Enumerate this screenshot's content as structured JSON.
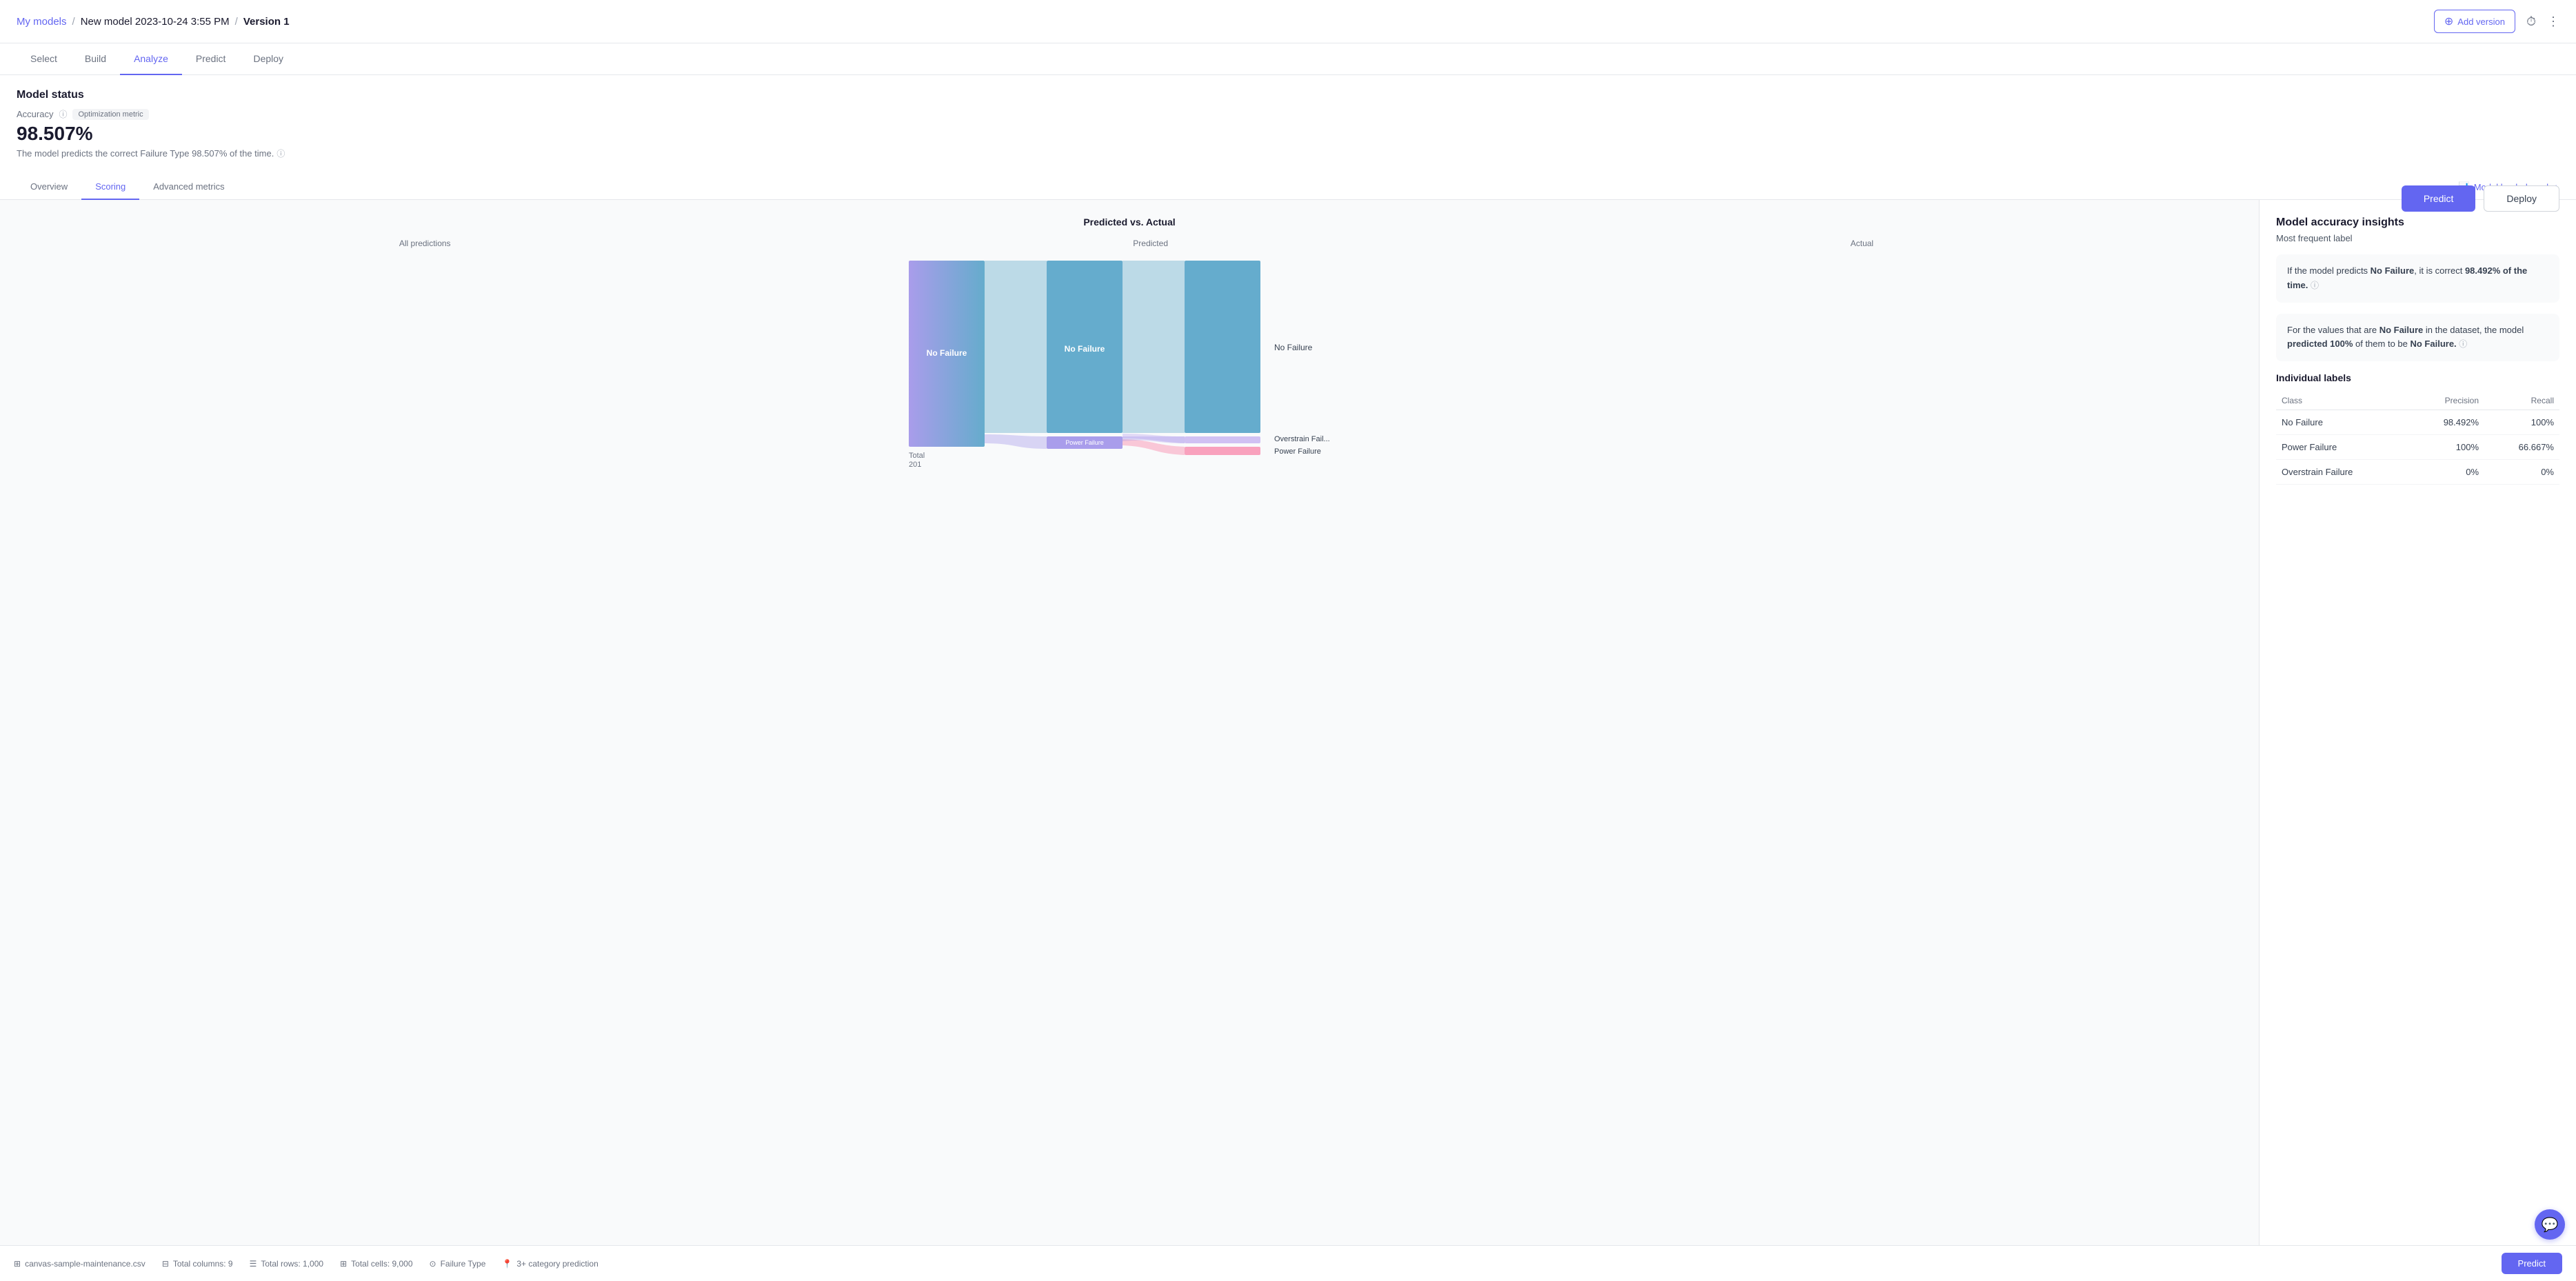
{
  "header": {
    "breadcrumb": "My models / New model 2023-10-24 3:55 PM / Version 1",
    "my_models": "My models",
    "separator1": "/",
    "model_name": "New model 2023-10-24 3:55 PM",
    "separator2": "/",
    "version": "Version 1",
    "add_version_label": "Add version"
  },
  "nav": {
    "tabs": [
      {
        "label": "Select",
        "active": false
      },
      {
        "label": "Build",
        "active": false
      },
      {
        "label": "Analyze",
        "active": true
      },
      {
        "label": "Predict",
        "active": false
      },
      {
        "label": "Deploy",
        "active": false
      }
    ]
  },
  "model_status": {
    "title": "Model status",
    "accuracy_label": "Accuracy",
    "optimization_badge": "Optimization metric",
    "accuracy_value": "98.507%",
    "accuracy_desc": "The model predicts the correct Failure Type 98.507% of the time.",
    "predict_button": "Predict",
    "deploy_button": "Deploy"
  },
  "sub_tabs": {
    "tabs": [
      {
        "label": "Overview",
        "active": false
      },
      {
        "label": "Scoring",
        "active": true
      },
      {
        "label": "Advanced metrics",
        "active": false
      }
    ],
    "leaderboard_label": "Model leaderboard"
  },
  "chart": {
    "title": "Predicted vs. Actual",
    "col_all": "All predictions",
    "col_predicted": "Predicted",
    "col_actual": "Actual",
    "total_label": "Total",
    "total_value": "201",
    "no_failure_center": "No Failure",
    "power_failure_center": "Power Failure",
    "no_failure_right": "No Failure",
    "overstrain_right": "Overstrain Fail...",
    "power_failure_right": "Power Failure"
  },
  "right_panel": {
    "title": "Model accuracy insights",
    "most_frequent_label": "Most frequent label",
    "insight1": "If the model predicts No Failure, it is correct 98.492% of the time.",
    "insight1_bold1": "No Failure",
    "insight1_bold2": "98.492% of the time.",
    "insight2_pre": "For the values that are",
    "insight2_bold1": "No Failure",
    "insight2_mid": "in the dataset, the model",
    "insight2_bold2": "predicted 100%",
    "insight2_post": "of them to be",
    "insight2_bold3": "No Failure.",
    "individual_labels_title": "Individual labels",
    "table": {
      "headers": [
        "Class",
        "Precision",
        "Recall"
      ],
      "rows": [
        {
          "class": "No Failure",
          "precision": "98.492%",
          "recall": "100%"
        },
        {
          "class": "Power Failure",
          "precision": "100%",
          "recall": "66.667%"
        },
        {
          "class": "Overstrain Failure",
          "precision": "0%",
          "recall": "0%"
        }
      ]
    }
  },
  "status_bar": {
    "file": "canvas-sample-maintenance.csv",
    "columns": "Total columns: 9",
    "rows": "Total rows: 1,000",
    "cells": "Total cells: 9,000",
    "target": "Failure Type",
    "prediction_type": "3+ category prediction",
    "predict_button": "Predict"
  }
}
